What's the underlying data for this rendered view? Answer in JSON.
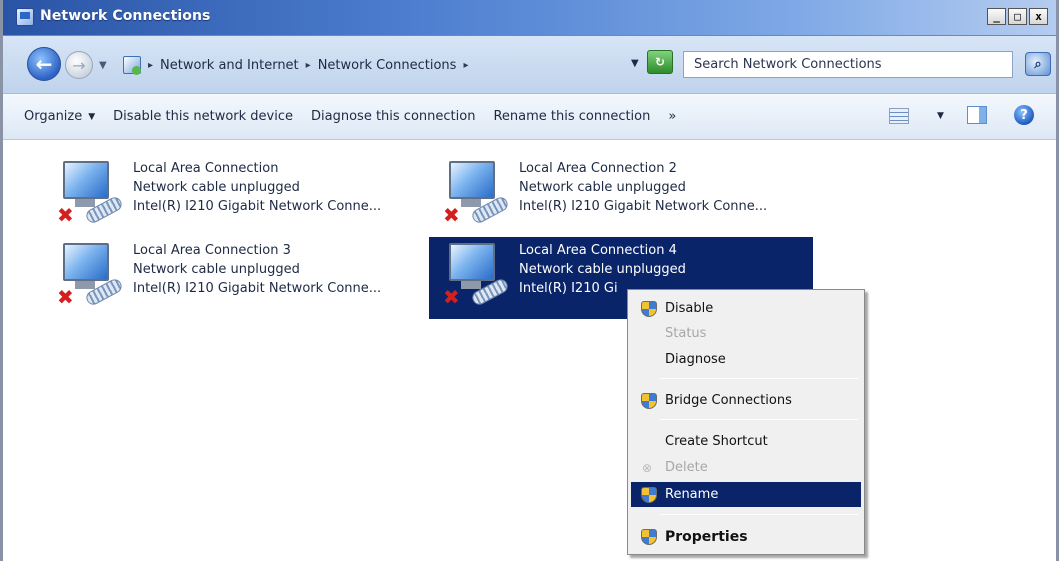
{
  "window": {
    "title": "Network Connections",
    "minimize": "_",
    "maximize": "□",
    "close": "x"
  },
  "address": {
    "crumb_separator": "▸",
    "breadcrumbs": [
      "Network and Internet",
      "Network Connections"
    ],
    "search_placeholder": "Search Network Connections"
  },
  "commandbar": {
    "organize": "Organize",
    "disable": "Disable this network device",
    "diagnose": "Diagnose this connection",
    "rename": "Rename this connection",
    "more": "»"
  },
  "connections": [
    {
      "name": "Local Area Connection",
      "status": "Network cable unplugged",
      "device": "Intel(R) I210 Gigabit Network Conne...",
      "selected": false
    },
    {
      "name": "Local Area Connection 2",
      "status": "Network cable unplugged",
      "device": "Intel(R) I210 Gigabit Network Conne...",
      "selected": false
    },
    {
      "name": "Local Area Connection 3",
      "status": "Network cable unplugged",
      "device": "Intel(R) I210 Gigabit Network Conne...",
      "selected": false
    },
    {
      "name": "Local Area Connection 4",
      "status": "Network cable unplugged",
      "device": "Intel(R) I210 Gi",
      "selected": true
    }
  ],
  "context_menu": {
    "items": [
      {
        "label": "Disable",
        "enabled": true,
        "icon": "shield-icon"
      },
      {
        "label": "Status",
        "enabled": false,
        "icon": ""
      },
      {
        "label": "Diagnose",
        "enabled": true,
        "icon": ""
      },
      {
        "label": "Bridge Connections",
        "enabled": true,
        "icon": "shield-icon"
      },
      {
        "label": "Create Shortcut",
        "enabled": true,
        "icon": ""
      },
      {
        "label": "Delete",
        "enabled": false,
        "icon": "delete-icon"
      },
      {
        "label": "Rename",
        "enabled": true,
        "icon": "shield-icon",
        "highlighted": true
      },
      {
        "label": "Properties",
        "enabled": true,
        "icon": "shield-icon",
        "bold": true
      }
    ]
  },
  "colors": {
    "selection": "#0a246a",
    "titlebar_start": "#2a54a6",
    "error_x": "#d41f1f"
  }
}
